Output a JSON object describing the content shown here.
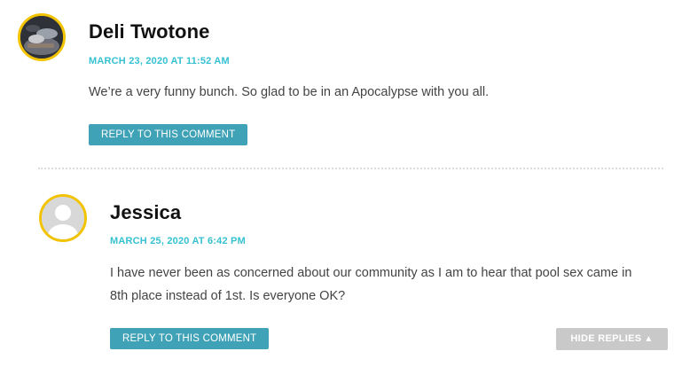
{
  "comments": [
    {
      "author": "Deli Twotone",
      "date": "MARCH 23, 2020 AT 11:52 AM",
      "text": "We’re a very funny bunch. So glad to be in an Apocalypse with you all.",
      "reply_label": "REPLY TO THIS COMMENT"
    },
    {
      "author": "Jessica",
      "date": "MARCH 25, 2020 AT 6:42 PM",
      "text": "I have never been as concerned about our community as I am to hear that pool sex came in 8th place instead of 1st. Is everyone OK?",
      "reply_label": "REPLY TO THIS COMMENT"
    }
  ],
  "hide_replies": {
    "label": "HIDE REPLIES",
    "icon": "▲"
  },
  "colors": {
    "avatar_ring": "#f2c300",
    "date": "#36c1d1",
    "reply_button": "#3fa2b6",
    "hide_button": "#c9c9c9"
  }
}
